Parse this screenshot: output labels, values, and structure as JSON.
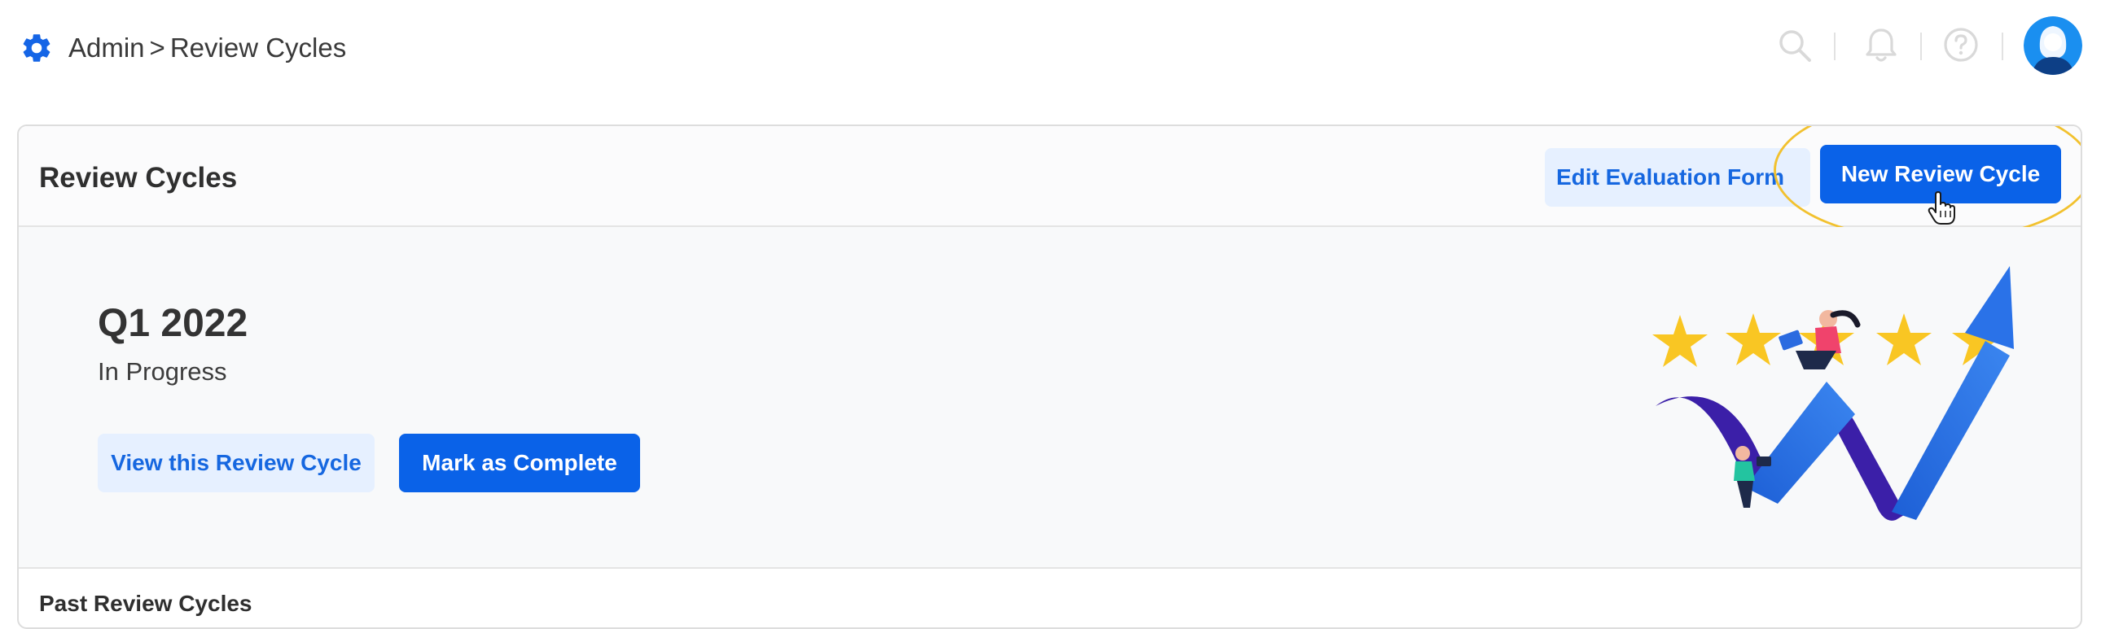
{
  "breadcrumb": {
    "parent": "Admin",
    "separator": ">",
    "current": "Review Cycles"
  },
  "topbar_icons": [
    "search-icon",
    "bell-icon",
    "help-icon"
  ],
  "card": {
    "title": "Review Cycles",
    "edit_form_label": "Edit Evaluation Form",
    "new_cycle_label": "New Review Cycle"
  },
  "current_cycle": {
    "name": "Q1 2022",
    "status": "In Progress",
    "view_label": "View this Review Cycle",
    "complete_label": "Mark as Complete"
  },
  "past": {
    "title": "Past Review Cycles"
  },
  "colors": {
    "accent": "#0a62e8",
    "accent_light": "#e6f0ff",
    "highlight": "#f2c12e",
    "star": "#f9c623"
  }
}
